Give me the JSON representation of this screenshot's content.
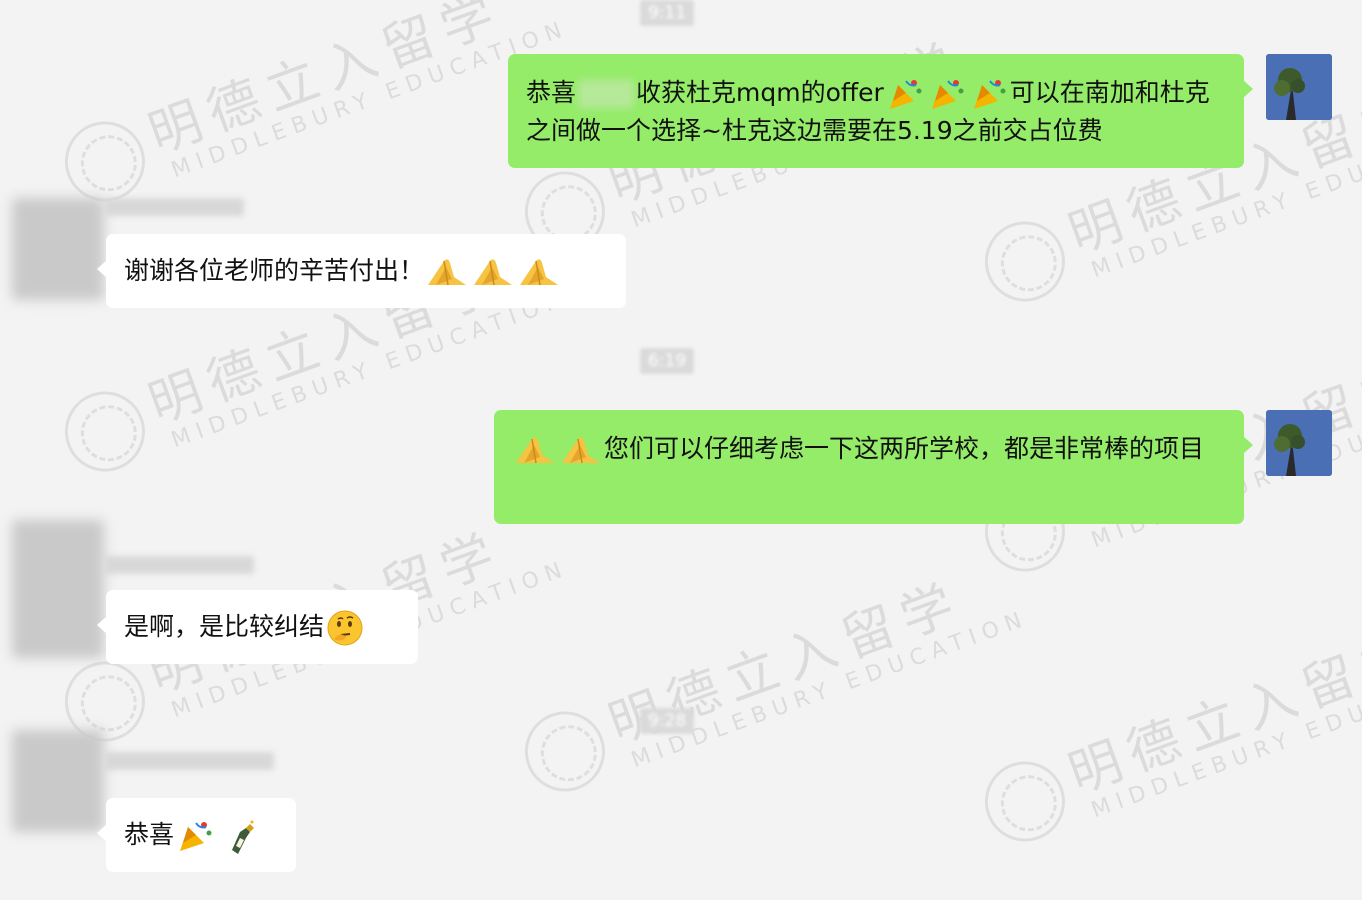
{
  "watermark": {
    "cn": "明德立入留学",
    "en": "MIDDLEBURY EDUCATION"
  },
  "timestamps": [
    "9:11",
    "6:19",
    "9:28"
  ],
  "messages": [
    {
      "sender": "self",
      "before_redaction": "恭喜",
      "text": "收获杜克mqm的offer",
      "after_emoji": "可以在南加和杜克之间做一个选择~杜克这边需要在5.19之前交占位费",
      "emojis": [
        "party-popper",
        "party-popper",
        "party-popper"
      ]
    },
    {
      "sender": "other",
      "text": "谢谢各位老师的辛苦付出！",
      "emojis": [
        "praying-hands",
        "praying-hands",
        "praying-hands"
      ]
    },
    {
      "sender": "self",
      "text": "您们可以仔细考虑一下这两所学校，都是非常棒的项目",
      "emojis": [
        "praying-hands",
        "praying-hands"
      ]
    },
    {
      "sender": "other",
      "text": "是啊，是比较纠结",
      "emojis": [
        "thinking-face"
      ]
    },
    {
      "sender": "other",
      "text": "恭喜",
      "emojis": [
        "party-popper",
        "champagne-bottle"
      ]
    }
  ]
}
